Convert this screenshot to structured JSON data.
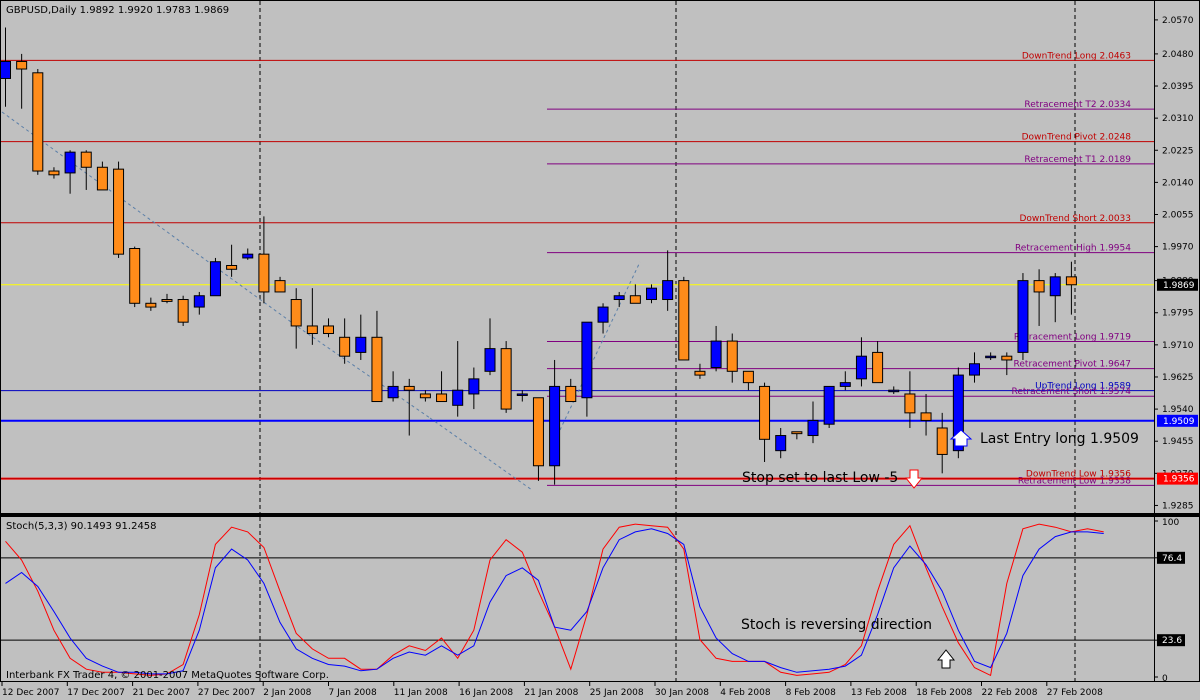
{
  "chart_data": [
    {
      "type": "candlestick",
      "header": "GBPUSD,Daily  1.9892 1.9920 1.9783 1.9869",
      "ylim": [
        1.9265,
        2.062
      ],
      "y_ticks": [
        "2.0570",
        "2.0480",
        "2.0395",
        "2.0310",
        "2.0225",
        "2.0140",
        "2.0055",
        "1.9970",
        "1.9880",
        "1.9795",
        "1.9710",
        "1.9625",
        "1.9540",
        "1.9455",
        "1.9370",
        "1.9285"
      ],
      "current_price_label": "1.9869",
      "entry_price_label": "1.9509",
      "stop_price_label": "1.9356",
      "colors": {
        "up": "#0000ff",
        "down": "#ff8c1a",
        "background": "#c0c0c0"
      },
      "candles": [
        [
          2.0415,
          2.055,
          2.034,
          2.046
        ],
        [
          2.046,
          2.048,
          2.0335,
          2.044
        ],
        [
          2.043,
          2.044,
          2.016,
          2.017
        ],
        [
          2.017,
          2.018,
          2.015,
          2.016
        ],
        [
          2.0165,
          2.0225,
          2.011,
          2.022
        ],
        [
          2.022,
          2.0225,
          2.012,
          2.018
        ],
        [
          2.018,
          2.0195,
          2.012,
          2.012
        ],
        [
          2.0175,
          2.0195,
          1.994,
          1.995
        ],
        [
          1.9965,
          1.997,
          1.981,
          1.982
        ],
        [
          1.982,
          1.9835,
          1.98,
          1.981
        ],
        [
          1.983,
          1.9845,
          1.982,
          1.9825
        ],
        [
          1.983,
          1.984,
          1.976,
          1.977
        ],
        [
          1.981,
          1.985,
          1.979,
          1.984
        ],
        [
          1.984,
          1.994,
          1.984,
          1.993
        ],
        [
          1.992,
          1.9975,
          1.989,
          1.991
        ],
        [
          1.994,
          1.9965,
          1.9935,
          1.995
        ],
        [
          1.995,
          2.005,
          1.982,
          1.985
        ],
        [
          1.988,
          1.989,
          1.985,
          1.985
        ],
        [
          1.983,
          1.986,
          1.97,
          1.976
        ],
        [
          1.976,
          1.986,
          1.971,
          1.974
        ],
        [
          1.976,
          1.978,
          1.973,
          1.974
        ],
        [
          1.973,
          1.978,
          1.966,
          1.968
        ],
        [
          1.969,
          1.979,
          1.967,
          1.973
        ],
        [
          1.973,
          1.98,
          1.956,
          1.956
        ],
        [
          1.957,
          1.964,
          1.956,
          1.96
        ],
        [
          1.96,
          1.962,
          1.947,
          1.959
        ],
        [
          1.958,
          1.959,
          1.956,
          1.957
        ],
        [
          1.958,
          1.964,
          1.956,
          1.956
        ],
        [
          1.955,
          1.972,
          1.952,
          1.959
        ],
        [
          1.958,
          1.965,
          1.954,
          1.962
        ],
        [
          1.964,
          1.978,
          1.963,
          1.97
        ],
        [
          1.97,
          1.972,
          1.953,
          1.954
        ],
        [
          1.958,
          1.959,
          1.956,
          1.958
        ],
        [
          1.957,
          1.957,
          1.935,
          1.939
        ],
        [
          1.939,
          1.967,
          1.934,
          1.96
        ],
        [
          1.96,
          1.962,
          1.956,
          1.956
        ],
        [
          1.957,
          1.977,
          1.952,
          1.977
        ],
        [
          1.977,
          1.982,
          1.974,
          1.981
        ],
        [
          1.983,
          1.985,
          1.981,
          1.984
        ],
        [
          1.984,
          1.987,
          1.983,
          1.982
        ],
        [
          1.983,
          1.987,
          1.982,
          1.986
        ],
        [
          1.983,
          1.996,
          1.98,
          1.988
        ],
        [
          1.988,
          1.989,
          1.967,
          1.967
        ],
        [
          1.964,
          1.966,
          1.962,
          1.963
        ],
        [
          1.965,
          1.976,
          1.964,
          1.972
        ],
        [
          1.972,
          1.974,
          1.961,
          1.964
        ],
        [
          1.964,
          1.964,
          1.959,
          1.961
        ],
        [
          1.96,
          1.961,
          1.94,
          1.946
        ],
        [
          1.943,
          1.949,
          1.941,
          1.947
        ],
        [
          1.948,
          1.948,
          1.946,
          1.9475
        ],
        [
          1.947,
          1.956,
          1.945,
          1.951
        ],
        [
          1.95,
          1.96,
          1.949,
          1.96
        ],
        [
          1.96,
          1.964,
          1.959,
          1.961
        ],
        [
          1.962,
          1.973,
          1.96,
          1.968
        ],
        [
          1.969,
          1.972,
          1.961,
          1.961
        ],
        [
          1.959,
          1.96,
          1.958,
          1.959
        ],
        [
          1.958,
          1.964,
          1.949,
          1.953
        ],
        [
          1.953,
          1.958,
          1.947,
          1.951
        ],
        [
          1.949,
          1.953,
          1.937,
          1.942
        ],
        [
          1.943,
          1.965,
          1.941,
          1.963
        ],
        [
          1.963,
          1.969,
          1.961,
          1.966
        ],
        [
          1.968,
          1.969,
          1.967,
          1.968
        ],
        [
          1.968,
          1.969,
          1.963,
          1.967
        ],
        [
          1.969,
          1.99,
          1.967,
          1.988
        ],
        [
          1.988,
          1.991,
          1.976,
          1.985
        ],
        [
          1.984,
          1.99,
          1.977,
          1.989
        ],
        [
          1.989,
          1.993,
          1.979,
          1.9869
        ]
      ],
      "trend_lines": [
        {
          "label": "DownTrend Long  2.0463",
          "value": 2.0463,
          "color": "#c00000"
        },
        {
          "label": "Retracement   T2   2.0334",
          "value": 2.0334,
          "color": "#800080"
        },
        {
          "label": "DownTrend Pivot  2.0248",
          "value": 2.0248,
          "color": "#c00000"
        },
        {
          "label": "Retracement   T1   2.0189",
          "value": 2.0189,
          "color": "#800080"
        },
        {
          "label": "DownTrend Short  2.0033",
          "value": 2.0033,
          "color": "#c00000"
        },
        {
          "label": "Retracement High   1.9954",
          "value": 1.9954,
          "color": "#800080"
        },
        {
          "label": "Retracement Long   1.9719",
          "value": 1.9719,
          "color": "#800080"
        },
        {
          "label": "Retracement Pivot   1.9647",
          "value": 1.9647,
          "color": "#800080"
        },
        {
          "label": "UpTrend Long  1.9589",
          "value": 1.9589,
          "color": "#0000c0"
        },
        {
          "label": "Retracement Short   1.9574",
          "value": 1.9574,
          "color": "#800080"
        },
        {
          "label": "Retracement Low   1.9338",
          "value": 1.9338,
          "color": "#800080"
        },
        {
          "label": "DownTrend Low  1.9356",
          "value": 1.9356,
          "color": "#c00000"
        }
      ],
      "annotations": {
        "entry": "Last Entry long 1.9509",
        "stop": "Stop set to last Low -5",
        "stoch_note": "Stoch is reversing direction"
      }
    },
    {
      "type": "line",
      "header": "Stoch(5,3,3) 90.1493 91.2458",
      "ylim": [
        0,
        100
      ],
      "y_ticks": [
        "100",
        "76.4",
        "23.6",
        "0"
      ],
      "levels": [
        76.4,
        23.6
      ],
      "series": [
        {
          "color": "#ff0000",
          "values": [
            87,
            75,
            55,
            30,
            12,
            5,
            3,
            3,
            2,
            1,
            2,
            8,
            40,
            85,
            96,
            93,
            83,
            55,
            28,
            18,
            12,
            12,
            5,
            5,
            14,
            20,
            17,
            25,
            12,
            30,
            75,
            88,
            80,
            55,
            32,
            5,
            40,
            82,
            96,
            98,
            97,
            96,
            82,
            24,
            12,
            10,
            10,
            10,
            3,
            1,
            2,
            3,
            8,
            20,
            55,
            85,
            97,
            70,
            45,
            22,
            6,
            1,
            60,
            95,
            98,
            96,
            93,
            95,
            93
          ]
        },
        {
          "color": "#0000ff",
          "values": [
            60,
            67,
            58,
            42,
            25,
            12,
            7,
            3,
            3,
            2,
            2,
            4,
            30,
            70,
            82,
            75,
            60,
            35,
            18,
            12,
            8,
            7,
            4,
            5,
            12,
            16,
            14,
            20,
            14,
            20,
            48,
            65,
            70,
            62,
            32,
            30,
            42,
            70,
            88,
            93,
            95,
            92,
            85,
            45,
            25,
            15,
            10,
            10,
            6,
            3,
            4,
            5,
            7,
            14,
            40,
            70,
            84,
            72,
            55,
            30,
            10,
            6,
            28,
            65,
            82,
            90,
            93,
            93,
            92
          ]
        }
      ],
      "x_ticks": [
        "12 Dec 2007",
        "17 Dec 2007",
        "21 Dec 2007",
        "27 Dec 2007",
        "2 Jan 2008",
        "7 Jan 2008",
        "11 Jan 2008",
        "16 Jan 2008",
        "21 Jan 2008",
        "25 Jan 2008",
        "30 Jan 2008",
        "4 Feb 2008",
        "8 Feb 2008",
        "13 Feb 2008",
        "18 Feb 2008",
        "22 Feb 2008",
        "27 Feb 2008"
      ],
      "copyright": "Interbank FX Trader 4, © 2001-2007 MetaQuotes Software Corp."
    }
  ]
}
